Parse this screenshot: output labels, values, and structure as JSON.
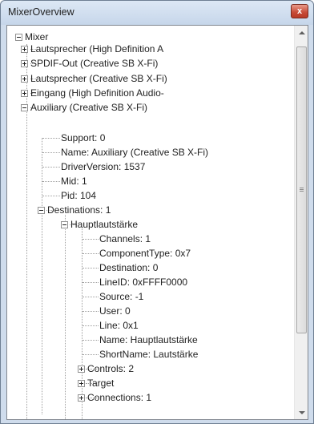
{
  "window": {
    "title": "MixerOverview",
    "close_label": "x"
  },
  "tree": {
    "root": "Mixer",
    "lines": [
      "Lautsprecher (High Definition A",
      "SPDIF-Out (Creative SB X-Fi)",
      "Lautsprecher (Creative SB X-Fi)",
      "Eingang (High Definition Audio-",
      "Auxiliary (Creative SB X-Fi)",
      "Support: 0",
      "Name: Auxiliary (Creative SB X-Fi)",
      "DriverVersion: 1537",
      "Mid: 1",
      "Pid: 104",
      "Destinations: 1",
      "Hauptlautstärke",
      "Channels: 1",
      "ComponentType: 0x7",
      "Destination: 0",
      "LineID: 0xFFFF0000",
      "Source: -1",
      "User: 0",
      "Line: 0x1",
      "Name: Hauptlautstärke",
      "ShortName: Lautstärke",
      "Controls: 2",
      "Target",
      "Connections: 1"
    ]
  },
  "scrollbar": {
    "position": 0.0
  }
}
